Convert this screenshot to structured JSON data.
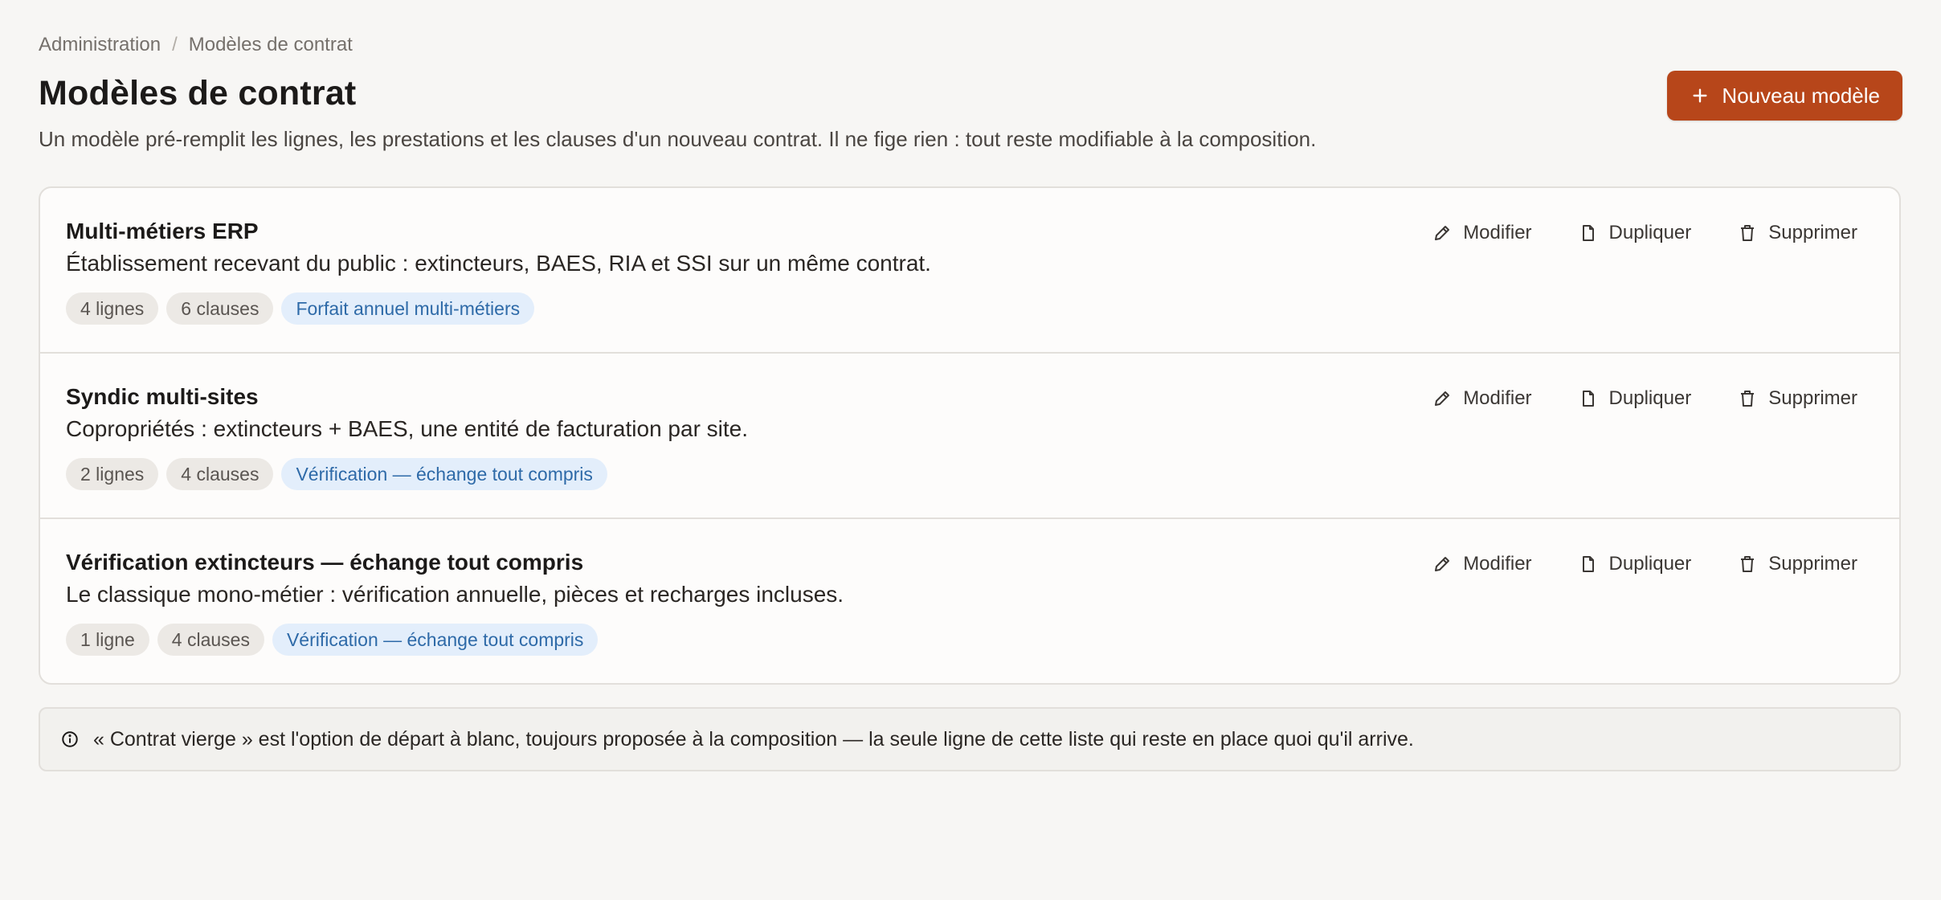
{
  "breadcrumb": {
    "root": "Administration",
    "separator": "/",
    "current": "Modèles de contrat"
  },
  "header": {
    "title": "Modèles de contrat",
    "subtitle": "Un modèle pré-remplit les lignes, les prestations et les clauses d'un nouveau contrat. Il ne fige rien : tout reste modifiable à la composition.",
    "new_button_label": "Nouveau modèle",
    "new_button_icon": "plus-icon"
  },
  "actions": {
    "edit_label": "Modifier",
    "edit_icon": "pencil-icon",
    "duplicate_label": "Dupliquer",
    "duplicate_icon": "document-icon",
    "delete_label": "Supprimer",
    "delete_icon": "trash-icon"
  },
  "templates": [
    {
      "title": "Multi-métiers ERP",
      "description": "Établissement recevant du public : extincteurs, BAES, RIA et SSI sur un même contrat.",
      "lines": "4 lignes",
      "clauses": "6 clauses",
      "pricing": "Forfait annuel multi-métiers"
    },
    {
      "title": "Syndic multi-sites",
      "description": "Copropriétés : extincteurs + BAES, une entité de facturation par site.",
      "lines": "2 lignes",
      "clauses": "4 clauses",
      "pricing": "Vérification — échange tout compris"
    },
    {
      "title": "Vérification extincteurs — échange tout compris",
      "description": "Le classique mono-métier : vérification annuelle, pièces et recharges incluses.",
      "lines": "1 ligne",
      "clauses": "4 clauses",
      "pricing": "Vérification — échange tout compris"
    }
  ],
  "info_note": {
    "icon": "info-icon",
    "text": "« Contrat vierge » est l'option de départ à blanc, toujours proposée à la composition — la seule ligne de cette liste qui reste en place quoi qu'il arrive."
  },
  "colors": {
    "accent": "#b7461a",
    "background": "#f7f6f4",
    "tag_blue_bg": "#e3eefb",
    "tag_blue_text": "#2e6aa8"
  }
}
